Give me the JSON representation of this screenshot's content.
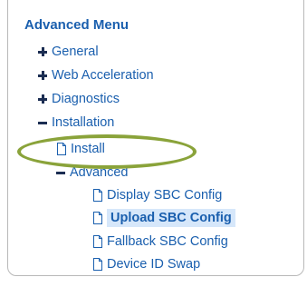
{
  "menu": {
    "title": "Advanced Menu",
    "items": [
      {
        "label": "General",
        "icon": "plus-icon",
        "state": "collapsed"
      },
      {
        "label": "Web Acceleration",
        "icon": "plus-icon",
        "state": "collapsed"
      },
      {
        "label": "Diagnostics",
        "icon": "plus-icon",
        "state": "collapsed"
      },
      {
        "label": "Installation",
        "icon": "minus-icon",
        "state": "expanded",
        "children": [
          {
            "label": "Install",
            "icon": "document-icon",
            "annotated": true
          },
          {
            "label": "Advanced",
            "icon": "minus-icon",
            "state": "expanded",
            "children": [
              {
                "label": "Display SBC Config",
                "icon": "document-icon"
              },
              {
                "label": "Upload SBC Config",
                "icon": "document-icon",
                "selected": true
              },
              {
                "label": "Fallback SBC Config",
                "icon": "document-icon"
              },
              {
                "label": "Device ID Swap",
                "icon": "document-icon"
              }
            ]
          }
        ]
      }
    ]
  },
  "colors": {
    "link_text": "#1a5fae",
    "tree_sign": "#1b2d52",
    "selected_background": "#d6e7fa",
    "annotation_ellipse": "#8aa33a",
    "panel_border": "#b9b9b9"
  }
}
